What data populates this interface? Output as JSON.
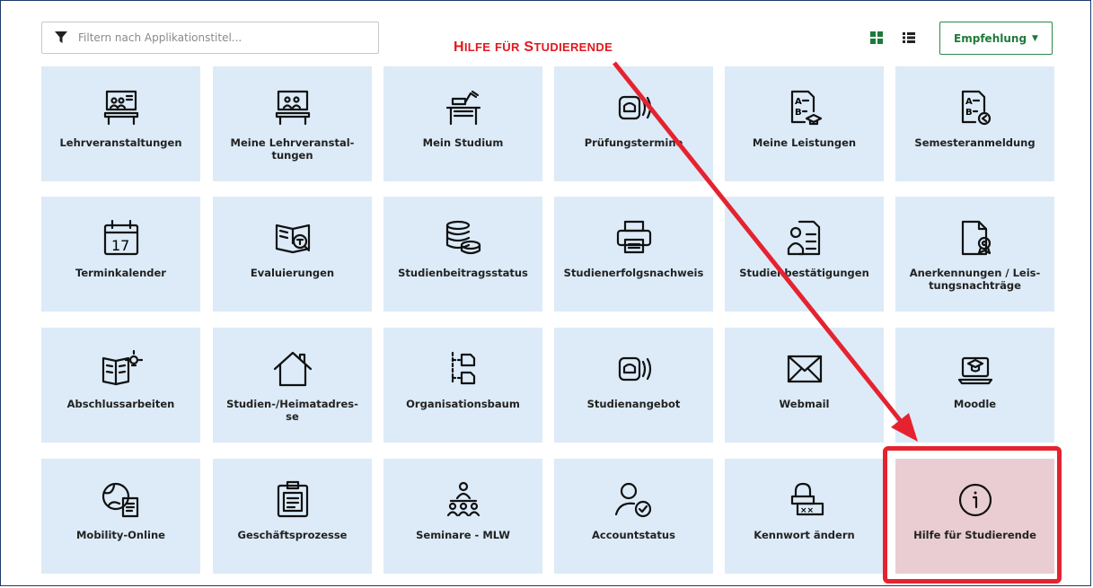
{
  "filter": {
    "placeholder": "Filtern nach Applikationstitel..."
  },
  "sort_button": {
    "label": "Empfehlung"
  },
  "annotation": {
    "label": "Hilfe für Studierende"
  },
  "colors": {
    "tile_bg": "#dcebf7",
    "highlight_bg": "#e9cdd3",
    "accent_green": "#1e7a3a",
    "annotation_red": "#e52330"
  },
  "tiles": [
    {
      "label": "Lehrveranstaltungen",
      "icon": "lecture-icon"
    },
    {
      "label": "Meine Lehrveranstal-\ntungen",
      "icon": "my-lecture-icon"
    },
    {
      "label": "Mein Studium",
      "icon": "desk-icon"
    },
    {
      "label": "Prüfungstermine",
      "icon": "exam-dates-icon"
    },
    {
      "label": "Meine Leistungen",
      "icon": "grades-icon"
    },
    {
      "label": "Semesteranmeldung",
      "icon": "semester-registration-icon"
    },
    {
      "label": "Terminkalender",
      "icon": "calendar-icon"
    },
    {
      "label": "Evaluierungen",
      "icon": "evaluation-icon"
    },
    {
      "label": "Studienbeitragsstatus",
      "icon": "coins-icon"
    },
    {
      "label": "Studienerfolgsnachweis",
      "icon": "printer-icon"
    },
    {
      "label": "Studienbestätigungen",
      "icon": "certificate-icon"
    },
    {
      "label": "Anerkennungen / Leis-\ntungsnachträge",
      "icon": "award-document-icon"
    },
    {
      "label": "Abschlussarbeiten",
      "icon": "thesis-icon"
    },
    {
      "label": "Studien-/Heimatadres-\nse",
      "icon": "home-icon"
    },
    {
      "label": "Organisationsbaum",
      "icon": "org-tree-icon"
    },
    {
      "label": "Studienangebot",
      "icon": "study-offer-icon"
    },
    {
      "label": "Webmail",
      "icon": "mail-icon"
    },
    {
      "label": "Moodle",
      "icon": "moodle-icon"
    },
    {
      "label": "Mobility-Online",
      "icon": "globe-document-icon"
    },
    {
      "label": "Geschäftsprozesse",
      "icon": "clipboard-icon"
    },
    {
      "label": "Seminare - MLW",
      "icon": "seminar-icon"
    },
    {
      "label": "Accountstatus",
      "icon": "user-check-icon"
    },
    {
      "label": "Kennwort ändern",
      "icon": "password-lock-icon"
    },
    {
      "label": "Hilfe für Studierende",
      "icon": "info-icon"
    }
  ]
}
